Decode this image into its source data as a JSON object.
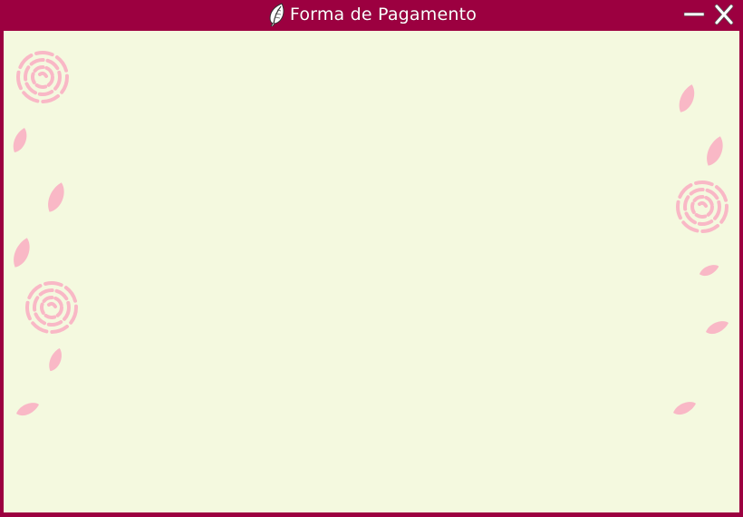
{
  "window": {
    "title": "Forma de Pagamento",
    "icon": "feather-icon",
    "controls": {
      "minimize_icon": "minimize-icon",
      "close_icon": "close-icon"
    }
  },
  "theme": {
    "frame_color": "#9c0040",
    "content_background": "#f4f9df",
    "decoration_color": "#f9b8c6",
    "decoration_names": [
      "rose-icon",
      "petal-icon"
    ]
  }
}
